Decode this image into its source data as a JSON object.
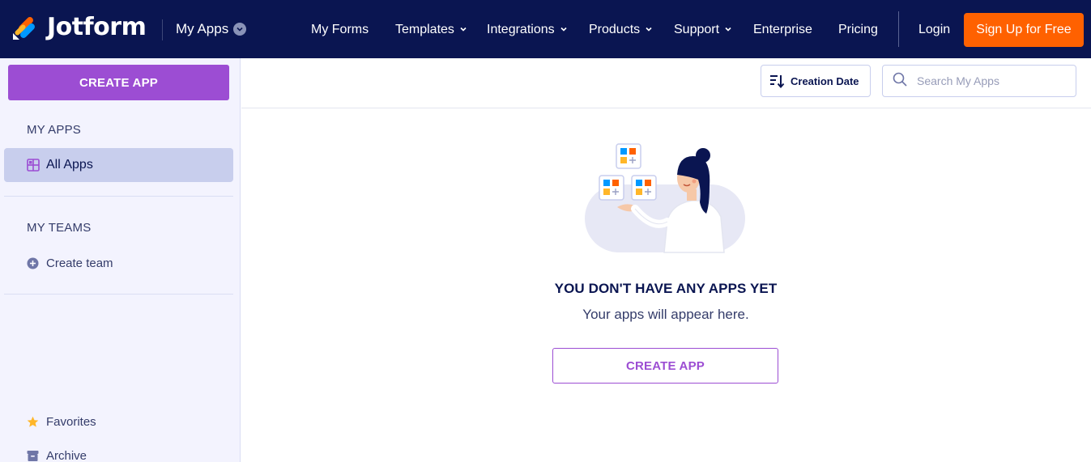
{
  "brand": {
    "name": "Jotform",
    "colors": {
      "navy": "#0a1551",
      "orange": "#ff6100",
      "purple": "#9c4dd3"
    }
  },
  "header": {
    "app_menu": "My Apps",
    "nav": [
      {
        "label": "My Forms",
        "dropdown": false
      },
      {
        "label": "Templates",
        "dropdown": true
      },
      {
        "label": "Integrations",
        "dropdown": true
      },
      {
        "label": "Products",
        "dropdown": true
      },
      {
        "label": "Support",
        "dropdown": true
      },
      {
        "label": "Enterprise",
        "dropdown": false
      },
      {
        "label": "Pricing",
        "dropdown": false
      }
    ],
    "login": "Login",
    "signup": "Sign Up for Free"
  },
  "sidebar": {
    "create_button": "CREATE APP",
    "my_apps_heading": "MY APPS",
    "all_apps": "All Apps",
    "my_teams_heading": "MY TEAMS",
    "create_team": "Create team",
    "favorites": "Favorites",
    "archive": "Archive"
  },
  "toolbar": {
    "sort_label": "Creation Date",
    "search_placeholder": "Search My Apps"
  },
  "empty_state": {
    "title": "YOU DON'T HAVE ANY APPS YET",
    "subtitle": "Your apps will appear here.",
    "button": "CREATE APP"
  }
}
